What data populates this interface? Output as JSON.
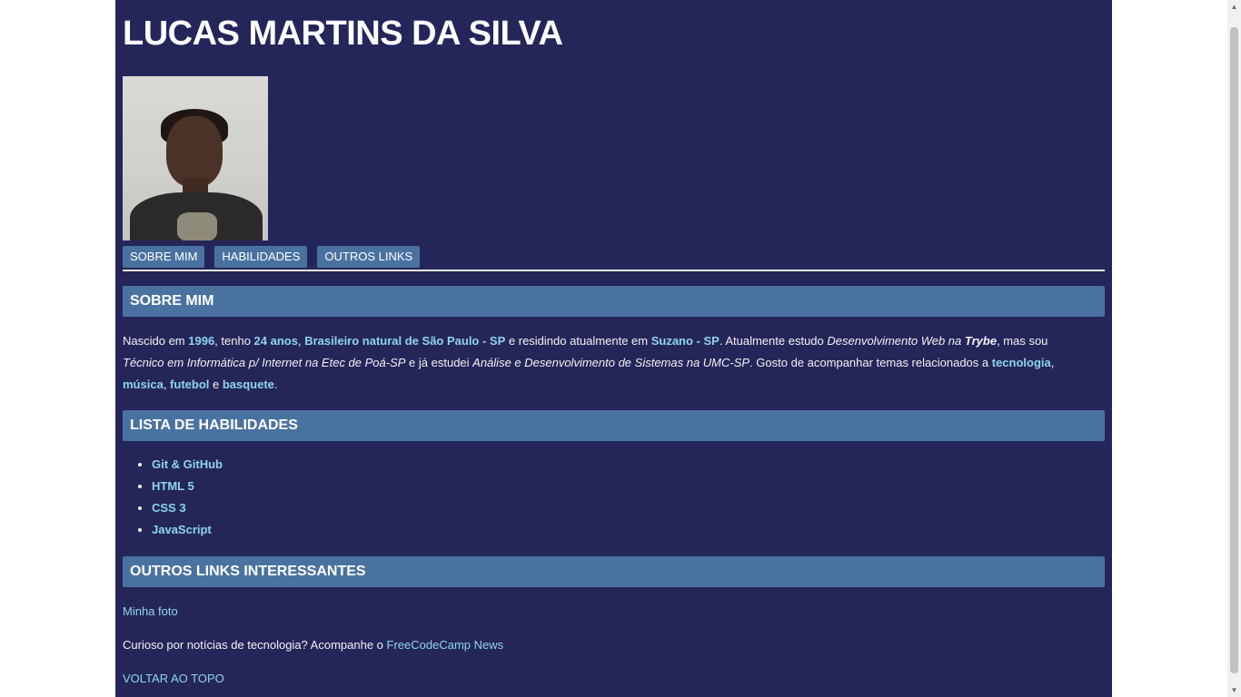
{
  "header": {
    "title": "LUCAS MARTINS DA SILVA"
  },
  "nav": {
    "items": [
      "SOBRE MIM",
      "HABILIDADES",
      "OUTROS LINKS"
    ]
  },
  "sections": {
    "about_title": "SOBRE MIM",
    "skills_title": "LISTA DE HABILIDADES",
    "links_title": "OUTROS LINKS INTERESSANTES"
  },
  "about": {
    "t1": "Nascido em ",
    "year": "1996",
    "t2": ", tenho ",
    "age": "24 anos",
    "t3": ", ",
    "origin": "Brasileiro natural de São Paulo - SP",
    "t4": " e residindo atualmente em ",
    "city": "Suzano - SP",
    "t5": ". Atualmente estudo ",
    "study": "Desenvolvimento Web na ",
    "school": "Trybe",
    "t6": ", mas sou ",
    "tech": "Técnico em Informática p/ Internet na Etec de Poá-SP",
    "t7": " e já estudei ",
    "college": "Análise e Desenvolvimento de Sistemas na UMC-SP",
    "t8": ". Gosto de acompanhar temas relacionados a ",
    "i1": "tecnologia",
    "c1": ", ",
    "i2": "música",
    "c2": ", ",
    "i3": "futebol",
    "c3": " e ",
    "i4": "basquete",
    "end": "."
  },
  "skills": [
    "Git & GitHub",
    "HTML 5",
    "CSS 3",
    "JavaScript"
  ],
  "links": {
    "photo_link": "Minha foto",
    "news_text": "Curioso por notícias de tecnologia? Acompanhe o ",
    "news_link": "FreeCodeCamp News",
    "back_top": "VOLTAR AO TOPO"
  }
}
